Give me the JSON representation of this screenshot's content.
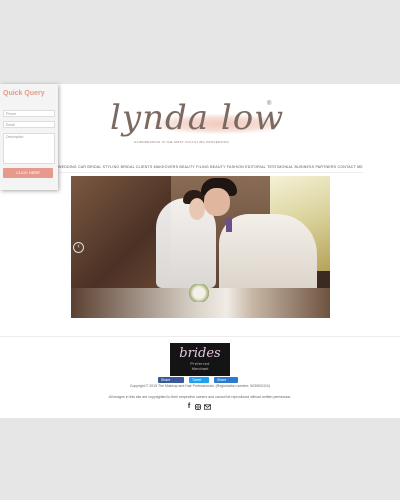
{
  "logo": {
    "script": "lynda low",
    "registered": "®",
    "tagline": "HAIRDRESSING IS THE MOST FULFILLING PROFESSION"
  },
  "nav": {
    "items": [
      "WEDDING CAR",
      "BRIDAL STYLING",
      "BRIDAL CLIENTS MAKEOVERS",
      "BEAUTY FILING",
      "BEAUTY FASHION EDITORIAL",
      "TESTIMONIAL",
      "BUSINESS PARTNERS",
      "CONTACT ME"
    ]
  },
  "slider": {
    "prev_arrow": "‹"
  },
  "badge": {
    "word": "brides",
    "sub1": "Preferred",
    "sub2": "Merchant"
  },
  "social": {
    "facebook": "Share",
    "twitter": "Tweet",
    "share": "Share"
  },
  "footer": {
    "copyright": "Copyright © 2015 The Makeup and Hair Professionals. (Registration number: 5039531GX)",
    "rights": "All images in this site are copyrighted to their respective owners and cannot be reproduced without written permission."
  },
  "quick_query": {
    "title": "Quick Query",
    "phone_placeholder": "Phone",
    "email_placeholder": "Email",
    "description_placeholder": "Description",
    "button": "CLICK HERE"
  },
  "colors": {
    "accent": "#e79a8c",
    "title": "#e59a85"
  }
}
